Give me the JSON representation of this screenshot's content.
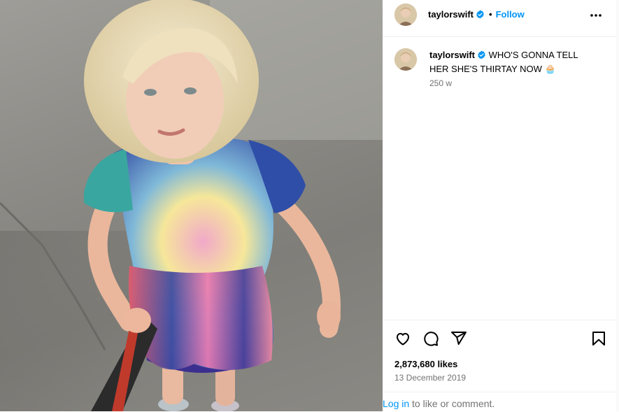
{
  "post": {
    "photo_alt": "Toddler in tie-dye dress on sidewalk"
  },
  "header": {
    "username": "taylorswift",
    "separator": "•",
    "follow_label": "Follow",
    "more_icon": "more-horizontal-icon"
  },
  "caption": {
    "username": "taylorswift",
    "text": "WHO'S GONNA TELL HER SHE'S THIRTAY NOW 🧁",
    "time_ago": "250 w"
  },
  "actions": {
    "like_icon": "heart-icon",
    "comment_icon": "comment-icon",
    "share_icon": "share-icon",
    "save_icon": "bookmark-icon"
  },
  "stats": {
    "likes": "2,873,680 likes",
    "date": "13 December 2019"
  },
  "login": {
    "link_label": "Log in",
    "rest_text": " to like or comment."
  },
  "colors": {
    "accent": "#0095f6",
    "verified": "#0095f6",
    "muted": "#737373",
    "divider": "#efefef"
  }
}
